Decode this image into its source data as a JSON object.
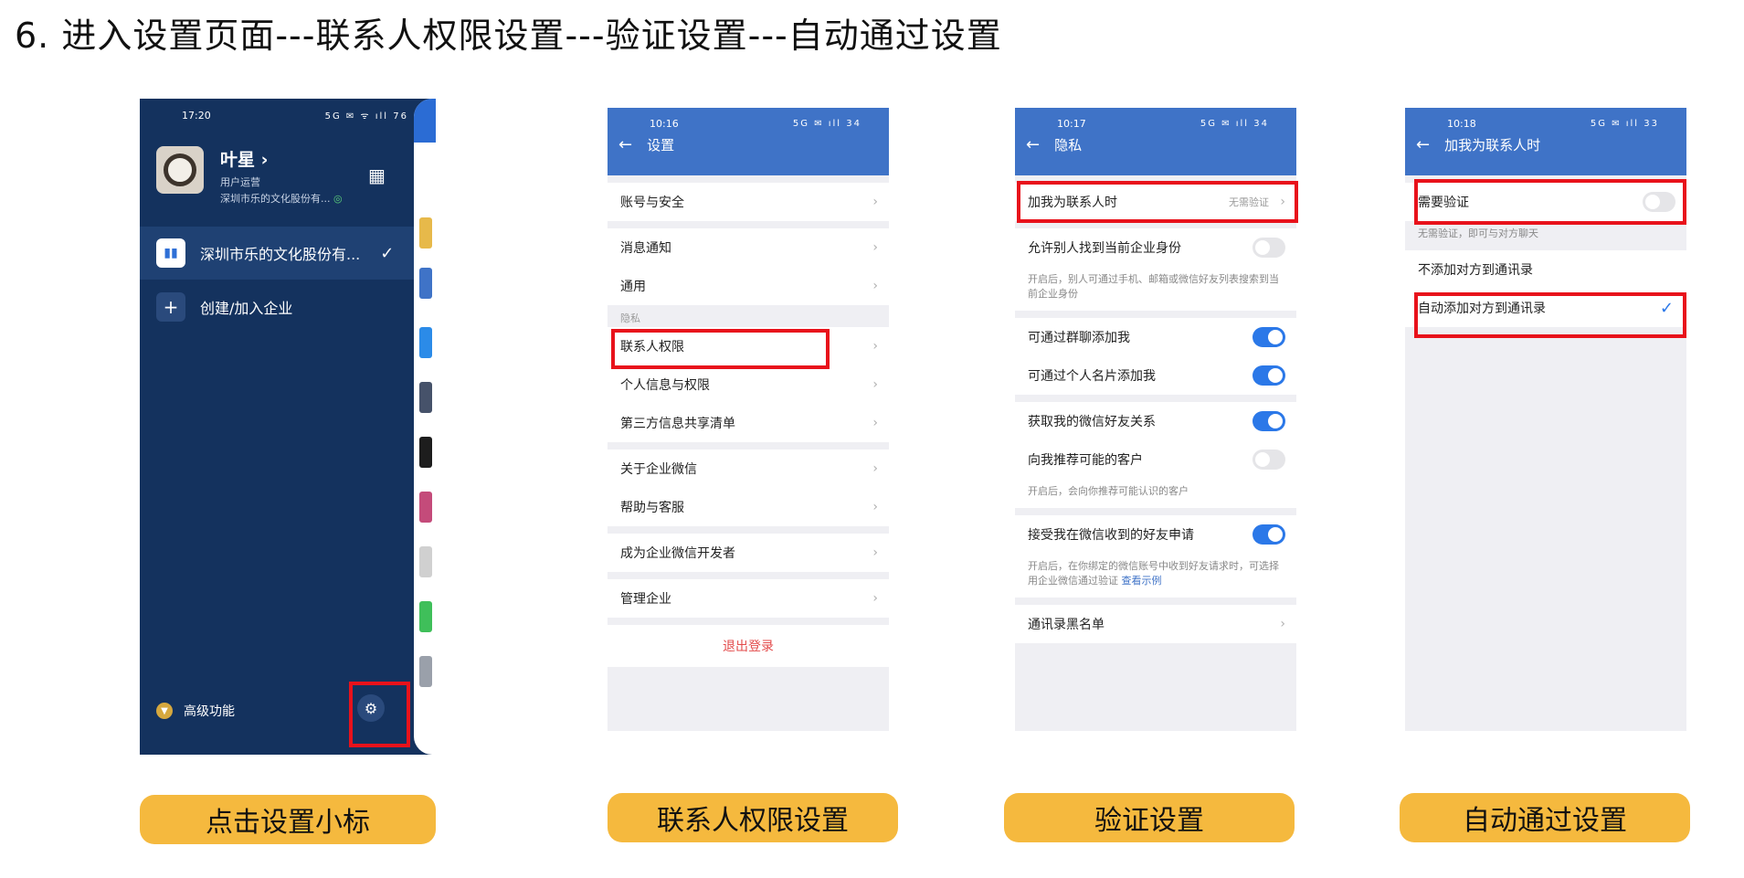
{
  "heading": "6. 进入设置页面---联系人权限设置---验证设置---自动通过设置",
  "phone1": {
    "time": "17:20",
    "status_icons": "5G ✉ ᯤ ıll 76",
    "name": "叶星",
    "role": "用户运营",
    "org_short": "深圳市乐的文化股份有...",
    "company": "深圳市乐的文化股份有...",
    "create_join": "创建/加入企业",
    "advanced": "高级功能"
  },
  "phone2": {
    "time": "10:16",
    "status_icons": "5G ✉ ıll 34",
    "title": "设置",
    "items": [
      "账号与安全",
      "消息通知",
      "通用"
    ],
    "privacy_label": "隐私",
    "privacy_items": [
      "联系人权限",
      "个人信息与权限",
      "第三方信息共享清单"
    ],
    "about_items": [
      "关于企业微信",
      "帮助与客服"
    ],
    "developer": "成为企业微信开发者",
    "manage": "管理企业",
    "logout": "退出登录"
  },
  "phone3": {
    "time": "10:17",
    "status_icons": "5G ✉ ıll 34",
    "title": "隐私",
    "add_me_when": "加我为联系人时",
    "add_me_value": "无需验证",
    "allow_find": "允许别人找到当前企业身份",
    "allow_find_note": "开启后，别人可通过手机、邮箱或微信好友列表搜索到当前企业身份",
    "via_group": "可通过群聊添加我",
    "via_card": "可通过个人名片添加我",
    "get_wechat": "获取我的微信好友关系",
    "recommend": "向我推荐可能的客户",
    "recommend_note": "开启后，会向你推荐可能认识的客户",
    "accept_wechat": "接受我在微信收到的好友申请",
    "accept_note": "开启后，在你绑定的微信账号中收到好友请求时，可选择用企业微信通过验证",
    "accept_link": "查看示例",
    "blacklist": "通讯录黑名单"
  },
  "phone4": {
    "time": "10:18",
    "status_icons": "5G ✉ ıll 33",
    "title": "加我为联系人时",
    "need_verify": "需要验证",
    "need_verify_note": "无需验证，即可与对方聊天",
    "no_add": "不添加对方到通讯录",
    "auto_add": "自动添加对方到通讯录"
  },
  "captions": [
    "点击设置小标",
    "联系人权限设置",
    "验证设置",
    "自动通过设置"
  ],
  "colors": {
    "highlight": "#e8121b",
    "caption_bg": "#f5b93e",
    "header_blue": "#3f73c7",
    "sidebar_navy": "#14325e"
  }
}
